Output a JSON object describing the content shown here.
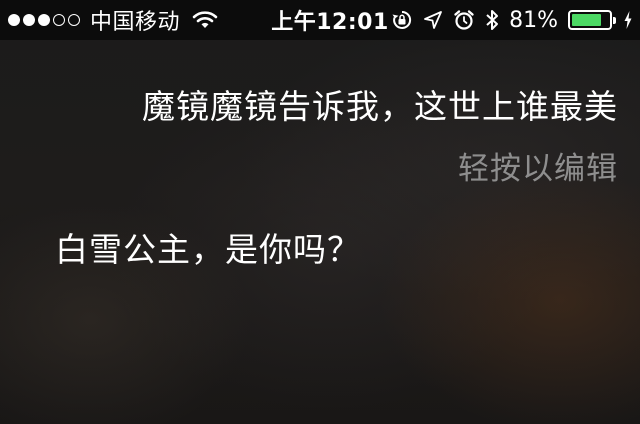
{
  "status_bar": {
    "signal_bars": [
      1,
      1,
      1,
      0,
      0
    ],
    "carrier": "中国移动",
    "time": "上午12:01",
    "battery_percent": "81%",
    "battery_level": 0.81,
    "icons": [
      "wifi-icon",
      "orientation-lock-icon",
      "location-arrow-icon",
      "alarm-icon",
      "bluetooth-icon",
      "battery-icon",
      "charging-bolt-icon"
    ],
    "battery_color": "#4cd964"
  },
  "siri": {
    "query": "魔镜魔镜告诉我，这世上谁最美",
    "edit_hint": "轻按以编辑",
    "reply": "白雪公主，是你吗？"
  }
}
